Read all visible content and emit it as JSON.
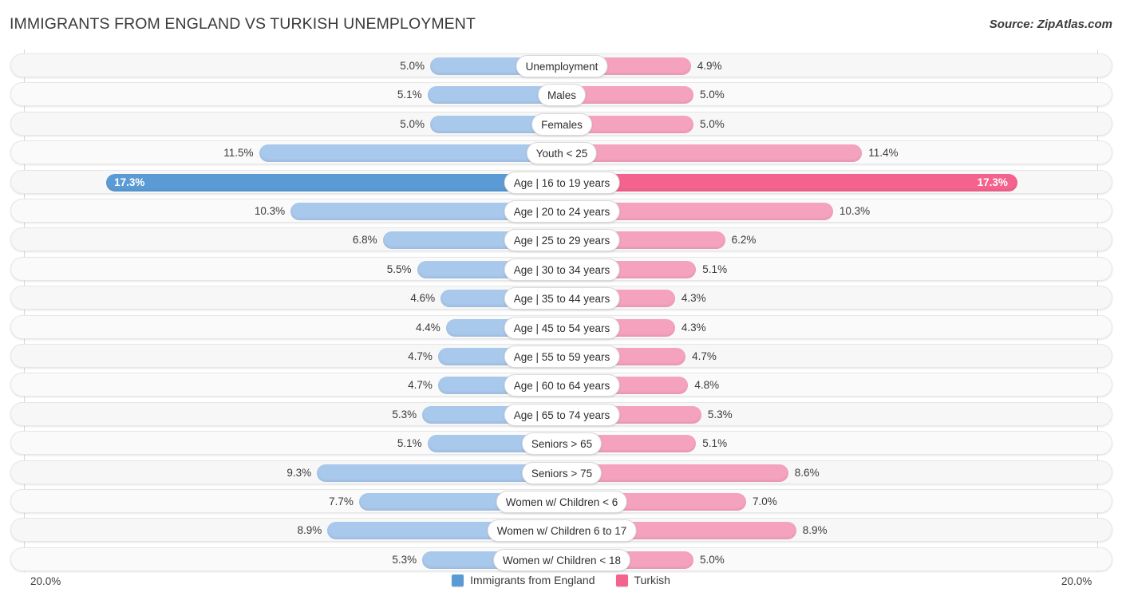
{
  "header": {
    "title": "IMMIGRANTS FROM ENGLAND VS TURKISH UNEMPLOYMENT",
    "source": "Source: ZipAtlas.com"
  },
  "footer": {
    "axis_left": "20.0%",
    "axis_right": "20.0%",
    "legend": [
      {
        "label": "Immigrants from England",
        "color": "#5b9bd5"
      },
      {
        "label": "Turkish",
        "color": "#f4628e"
      }
    ]
  },
  "chart_data": {
    "type": "bar",
    "title": "IMMIGRANTS FROM ENGLAND VS TURKISH UNEMPLOYMENT",
    "subtitle": "Source: ZipAtlas.com",
    "orientation": "horizontal-diverging",
    "xlabel": "",
    "ylabel": "",
    "xlim": [
      20.0,
      20.0
    ],
    "axis_max": 20.0,
    "grid": false,
    "legend_position": "bottom-center",
    "categories": [
      "Unemployment",
      "Males",
      "Females",
      "Youth < 25",
      "Age | 16 to 19 years",
      "Age | 20 to 24 years",
      "Age | 25 to 29 years",
      "Age | 30 to 34 years",
      "Age | 35 to 44 years",
      "Age | 45 to 54 years",
      "Age | 55 to 59 years",
      "Age | 60 to 64 years",
      "Age | 65 to 74 years",
      "Seniors > 65",
      "Seniors > 75",
      "Women w/ Children < 6",
      "Women w/ Children 6 to 17",
      "Women w/ Children < 18"
    ],
    "series": [
      {
        "name": "Immigrants from England",
        "color": "#5b9bd5",
        "side": "left",
        "values": [
          5.0,
          5.1,
          5.0,
          11.5,
          17.3,
          10.3,
          6.8,
          5.5,
          4.6,
          4.4,
          4.7,
          4.7,
          5.3,
          5.1,
          9.3,
          7.7,
          8.9,
          5.3
        ],
        "labels": [
          "5.0%",
          "5.1%",
          "5.0%",
          "11.5%",
          "17.3%",
          "10.3%",
          "6.8%",
          "5.5%",
          "4.6%",
          "4.4%",
          "4.7%",
          "4.7%",
          "5.3%",
          "5.1%",
          "9.3%",
          "7.7%",
          "8.9%",
          "5.3%"
        ]
      },
      {
        "name": "Turkish",
        "color": "#f4628e",
        "side": "right",
        "values": [
          4.9,
          5.0,
          5.0,
          11.4,
          17.3,
          10.3,
          6.2,
          5.1,
          4.3,
          4.3,
          4.7,
          4.8,
          5.3,
          5.1,
          8.6,
          7.0,
          8.9,
          5.0
        ],
        "labels": [
          "4.9%",
          "5.0%",
          "5.0%",
          "11.4%",
          "17.3%",
          "10.3%",
          "6.2%",
          "5.1%",
          "4.3%",
          "4.3%",
          "4.7%",
          "4.8%",
          "5.3%",
          "5.1%",
          "8.6%",
          "7.0%",
          "8.9%",
          "5.0%"
        ]
      }
    ]
  }
}
